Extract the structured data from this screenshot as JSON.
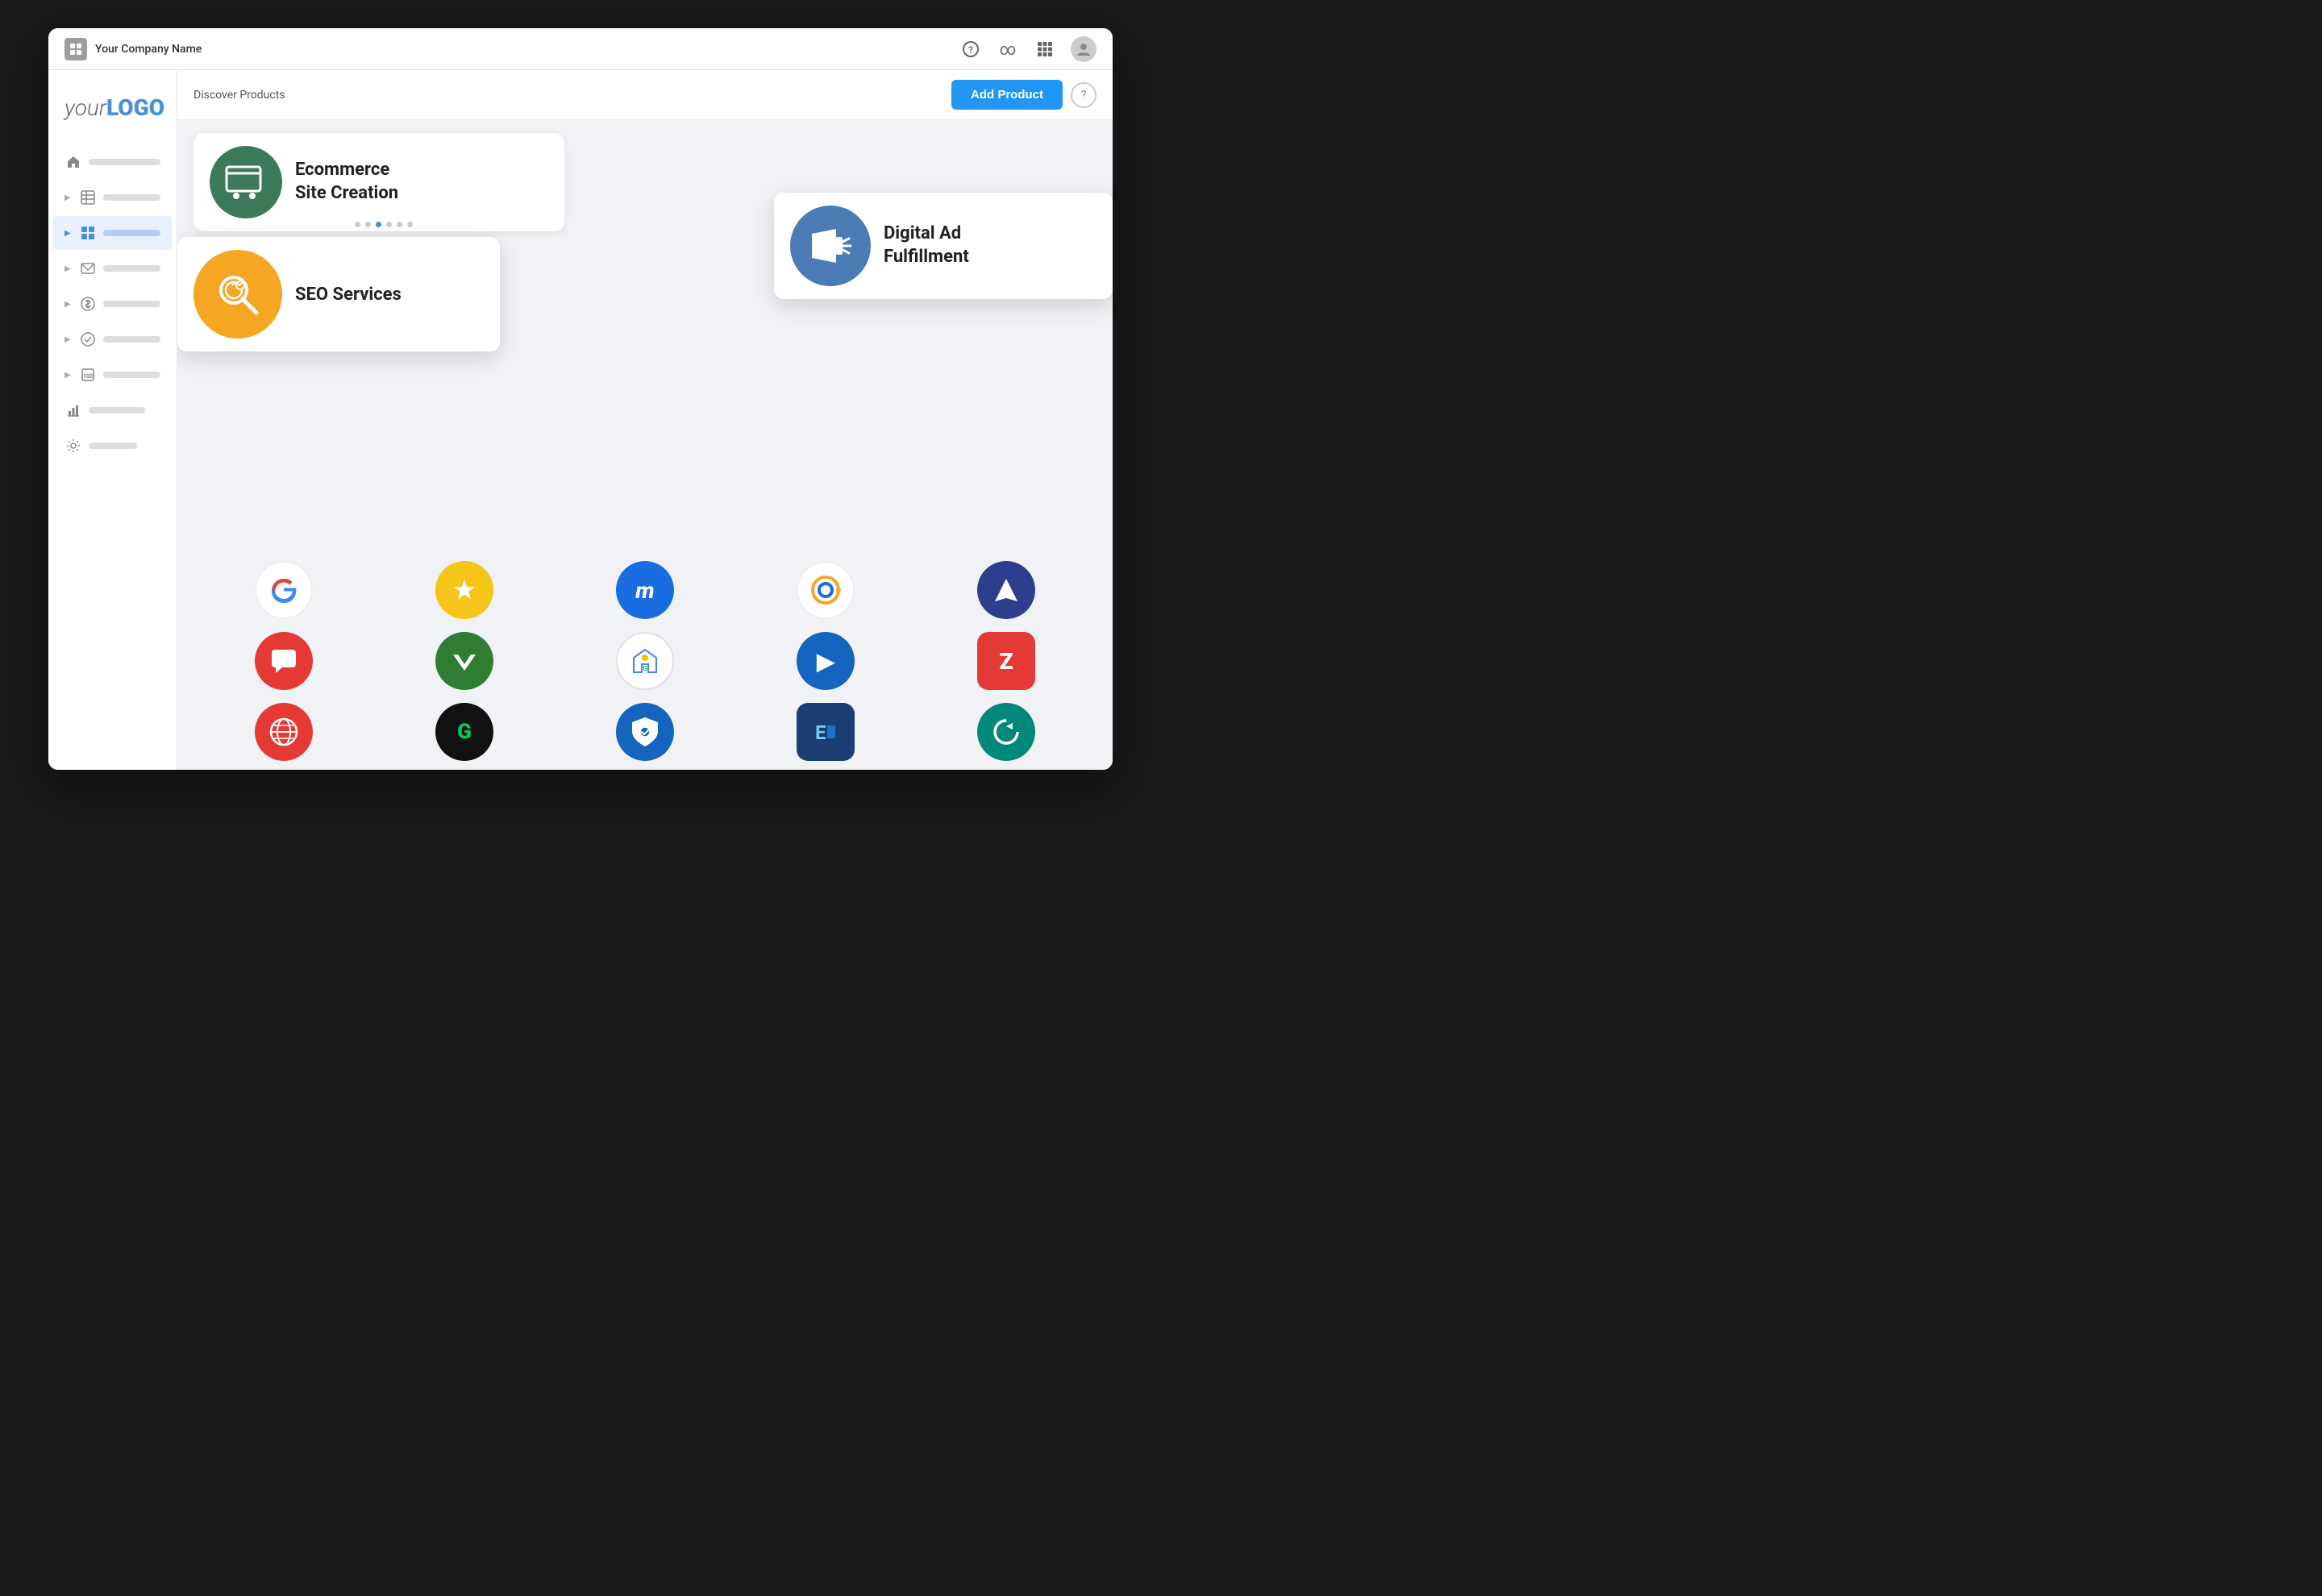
{
  "topnav": {
    "company_name": "Your Company Name",
    "icons": {
      "help": "?",
      "infinity": "∞",
      "grid": "⊞",
      "user": "👤"
    }
  },
  "sidebar": {
    "logo": {
      "italic": "your",
      "bold": "LOGO"
    },
    "items": [
      {
        "id": "home",
        "icon": "🏠",
        "has_chevron": false
      },
      {
        "id": "table",
        "icon": "⊞",
        "has_chevron": true
      },
      {
        "id": "grid",
        "icon": "⋮⋮⋮",
        "has_chevron": true,
        "active": true
      },
      {
        "id": "mail",
        "icon": "✉",
        "has_chevron": true
      },
      {
        "id": "dollar",
        "icon": "$",
        "has_chevron": true
      },
      {
        "id": "check",
        "icon": "✓",
        "has_chevron": true
      },
      {
        "id": "badge",
        "icon": "▦",
        "has_chevron": true
      },
      {
        "id": "chart",
        "icon": "📊",
        "has_chevron": false
      },
      {
        "id": "gear",
        "icon": "⚙",
        "has_chevron": false
      }
    ]
  },
  "header": {
    "discover_title": "Discover Products",
    "add_product_label": "Add Product",
    "help_label": "?"
  },
  "featured_products": [
    {
      "id": "ecommerce",
      "label": "Ecommerce\nSite Creation",
      "icon_color": "green",
      "icon_type": "cart"
    },
    {
      "id": "seo",
      "label": "SEO Services",
      "icon_color": "orange",
      "icon_type": "seo"
    },
    {
      "id": "digital-ad",
      "label": "Digital Ad\nFulfillment",
      "icon_color": "blue-dark",
      "icon_type": "megaphone"
    }
  ],
  "brand_icons": [
    {
      "id": "google",
      "label": "G",
      "color": "#4285F4",
      "style": "google",
      "text_color": "#4285F4"
    },
    {
      "id": "yotpo",
      "label": "★",
      "color": "#f5c518",
      "text_color": "white"
    },
    {
      "id": "mailcharts",
      "label": "m",
      "color": "#1a6de0",
      "text_color": "white"
    },
    {
      "id": "conductor",
      "label": "⊙",
      "color": "#f5a623",
      "border": true,
      "text_color": "#f5a623"
    },
    {
      "id": "aritic",
      "label": "▲",
      "color": "#2c3e8c",
      "text_color": "white"
    },
    {
      "id": "chatlio",
      "label": "💬",
      "color": "#e53935",
      "text_color": "white"
    },
    {
      "id": "vwo",
      "label": "▽",
      "color": "#2e7d32",
      "text_color": "white"
    },
    {
      "id": "google-business",
      "label": "🏪",
      "color": "#1565c0",
      "border": true,
      "text_color": "#1565c0"
    },
    {
      "id": "promptly",
      "label": "▶",
      "color": "#1565c0",
      "text_color": "white"
    },
    {
      "id": "zoho",
      "label": "Z",
      "color": "#e53935",
      "border": true,
      "text_color": "white",
      "bg": "#e53935"
    },
    {
      "id": "sitechecker",
      "label": "🌐",
      "color": "#e53935",
      "text_color": "white"
    },
    {
      "id": "godaddy",
      "label": "G",
      "color": "#111",
      "text_color": "#00c853",
      "bg": "#111"
    },
    {
      "id": "shield",
      "label": "🛡",
      "color": "#1565c0",
      "text_color": "white"
    },
    {
      "id": "excel",
      "label": "E",
      "color": "#1a3e72",
      "text_color": "white",
      "bg": "#1a3e72"
    },
    {
      "id": "zight",
      "label": "↺",
      "color": "#00897b",
      "text_color": "white"
    }
  ],
  "carousel_dots": [
    false,
    false,
    true,
    false,
    false,
    false
  ]
}
